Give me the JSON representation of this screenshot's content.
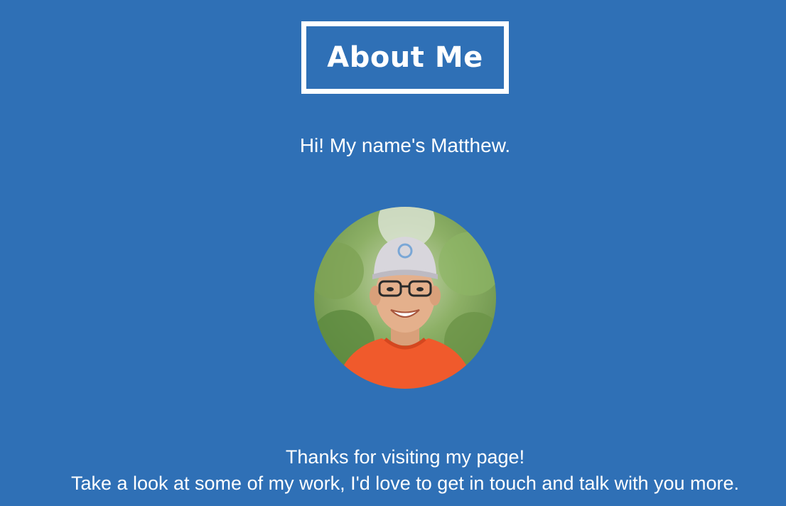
{
  "header": {
    "title": "About Me"
  },
  "intro": {
    "greeting": "Hi! My name's Matthew."
  },
  "profile": {
    "avatar_icon": "profile-photo"
  },
  "footer": {
    "line1": "Thanks for visiting my page!",
    "line2": "Take a look at some of my work, I'd love to get in touch and talk with you more."
  },
  "colors": {
    "background": "#2f70b6",
    "text": "#ffffff",
    "shirt": "#f05a2c",
    "foliage": "#7fa35a"
  }
}
